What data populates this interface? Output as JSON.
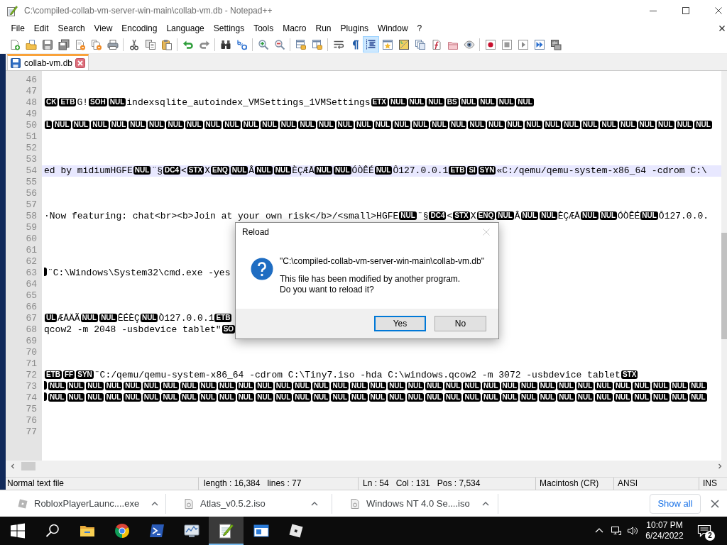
{
  "window": {
    "title": "C:\\compiled-collab-vm-server-win-main\\collab-vm.db - Notepad++"
  },
  "menu": [
    "File",
    "Edit",
    "Search",
    "View",
    "Encoding",
    "Language",
    "Settings",
    "Tools",
    "Macro",
    "Run",
    "Plugins",
    "Window",
    "?"
  ],
  "toolbar": [
    [
      {
        "kind": "new",
        "pressed": false
      },
      {
        "kind": "open",
        "pressed": false
      },
      {
        "kind": "save",
        "pressed": false
      },
      {
        "kind": "save_all",
        "pressed": false
      },
      {
        "kind": "close",
        "pressed": false
      },
      {
        "kind": "close_all",
        "pressed": false
      },
      {
        "kind": "print",
        "pressed": false
      }
    ],
    [
      {
        "kind": "cut",
        "pressed": false
      },
      {
        "kind": "copy",
        "pressed": false
      },
      {
        "kind": "paste",
        "pressed": false
      }
    ],
    [
      {
        "kind": "undo",
        "pressed": false
      },
      {
        "kind": "redo",
        "pressed": false
      }
    ],
    [
      {
        "kind": "find",
        "pressed": false
      },
      {
        "kind": "replace",
        "pressed": false
      }
    ],
    [
      {
        "kind": "zoom_in",
        "pressed": false
      },
      {
        "kind": "zoom_out",
        "pressed": false
      }
    ],
    [
      {
        "kind": "sync_v",
        "pressed": false
      },
      {
        "kind": "sync_h",
        "pressed": false
      }
    ],
    [
      {
        "kind": "wrap",
        "pressed": false
      },
      {
        "kind": "all_chars",
        "pressed": false
      },
      {
        "kind": "indent_guide",
        "pressed": true
      },
      {
        "kind": "user_lang",
        "pressed": false
      },
      {
        "kind": "doc_map",
        "pressed": false
      },
      {
        "kind": "doc_list",
        "pressed": false
      },
      {
        "kind": "func_list",
        "pressed": false
      },
      {
        "kind": "folder",
        "pressed": false
      },
      {
        "kind": "monitor",
        "pressed": false
      }
    ],
    [
      {
        "kind": "record",
        "pressed": false
      },
      {
        "kind": "stop",
        "pressed": false
      },
      {
        "kind": "play",
        "pressed": false
      },
      {
        "kind": "run_multi",
        "pressed": false
      },
      {
        "kind": "save_macro",
        "pressed": false
      }
    ]
  ],
  "tabs": [
    {
      "label": "collab-vm.db",
      "selected": true,
      "modified": false
    }
  ],
  "editor": {
    "lines": [
      {
        "number": "46",
        "current": false
      },
      {
        "number": "47",
        "current": false
      },
      {
        "number": "48",
        "current": false,
        "segments": [
          {
            "kind": "ctrl",
            "codes": [
              "CK",
              "ETB"
            ]
          },
          {
            "kind": "text",
            "text": "G!"
          },
          {
            "kind": "ctrl",
            "codes": [
              "SOH",
              "NUL"
            ]
          },
          {
            "kind": "text",
            "text": "indexsqlite_autoindex_VMSettings_1VMSettings"
          },
          {
            "kind": "ctrl",
            "codes": [
              "ETX",
              "NUL",
              "NUL",
              "NUL",
              "BS",
              "NUL",
              "NUL",
              "NUL",
              "NUL"
            ]
          }
        ]
      },
      {
        "number": "49",
        "current": false
      },
      {
        "number": "50",
        "current": false,
        "segments": [
          {
            "kind": "ctrl",
            "codes": [
              "L",
              "NUL",
              "NUL",
              "NUL",
              "NUL",
              "NUL",
              "NUL",
              "NUL",
              "NUL",
              "NUL",
              "NUL",
              "NUL",
              "NUL",
              "NUL",
              "NUL",
              "NUL",
              "NUL",
              "NUL",
              "NUL",
              "NUL",
              "NUL",
              "NUL",
              "NUL",
              "NUL",
              "NUL",
              "NUL",
              "NUL",
              "NUL",
              "NUL",
              "NUL",
              "NUL",
              "NUL",
              "NUL",
              "NUL",
              "NUL",
              "NUL"
            ]
          }
        ]
      },
      {
        "number": "51",
        "current": false
      },
      {
        "number": "52",
        "current": false
      },
      {
        "number": "53",
        "current": false
      },
      {
        "number": "54",
        "current": true,
        "segments": [
          {
            "kind": "text",
            "text": "ed by midiumHGFE"
          },
          {
            "kind": "ctrl",
            "codes": [
              "NUL"
            ]
          },
          {
            "kind": "text",
            "text": "¨§"
          },
          {
            "kind": "ctrl",
            "codes": [
              "DC4"
            ]
          },
          {
            "kind": "text",
            "text": "<"
          },
          {
            "kind": "ctrl",
            "codes": [
              "STX"
            ]
          },
          {
            "kind": "text",
            "text": "X"
          },
          {
            "kind": "ctrl",
            "codes": [
              "ENQ",
              "NUL"
            ]
          },
          {
            "kind": "text",
            "text": "Â"
          },
          {
            "kind": "ctrl",
            "codes": [
              "NUL",
              "NUL"
            ]
          },
          {
            "kind": "text",
            "text": "ÈÇÆÅ"
          },
          {
            "kind": "ctrl",
            "codes": [
              "NUL",
              "NUL"
            ]
          },
          {
            "kind": "text",
            "text": "ÓÒÊÉ"
          },
          {
            "kind": "ctrl",
            "codes": [
              "NUL"
            ]
          },
          {
            "kind": "text",
            "text": "Ô127.0.0.1"
          },
          {
            "kind": "ctrl",
            "codes": [
              "ETB",
              "SI",
              "SYN"
            ]
          },
          {
            "kind": "text",
            "text": "«C:/qemu/qemu-system-x86_64 -cdrom C:\\"
          }
        ]
      },
      {
        "number": "55",
        "current": false
      },
      {
        "number": "56",
        "current": false
      },
      {
        "number": "57",
        "current": false
      },
      {
        "number": "58",
        "current": false,
        "segments": [
          {
            "kind": "text",
            "text": "·Now featuring: chat<br><b>Join at your own risk</b>/<small>HGFE"
          },
          {
            "kind": "ctrl",
            "codes": [
              "NUL"
            ]
          },
          {
            "kind": "text",
            "text": "¨§"
          },
          {
            "kind": "ctrl",
            "codes": [
              "DC4"
            ]
          },
          {
            "kind": "text",
            "text": "<"
          },
          {
            "kind": "ctrl",
            "codes": [
              "STX"
            ]
          },
          {
            "kind": "text",
            "text": "X"
          },
          {
            "kind": "ctrl",
            "codes": [
              "ENQ",
              "NUL"
            ]
          },
          {
            "kind": "text",
            "text": "Â"
          },
          {
            "kind": "ctrl",
            "codes": [
              "NUL",
              "NUL"
            ]
          },
          {
            "kind": "text",
            "text": "ÈÇÆÅ"
          },
          {
            "kind": "ctrl",
            "codes": [
              "NUL",
              "NUL"
            ]
          },
          {
            "kind": "text",
            "text": "ÓÒÊÉ"
          },
          {
            "kind": "ctrl",
            "codes": [
              "NUL"
            ]
          },
          {
            "kind": "text",
            "text": "Ô127.0.0."
          }
        ]
      },
      {
        "number": "59",
        "current": false
      },
      {
        "number": "60",
        "current": false
      },
      {
        "number": "61",
        "current": false
      },
      {
        "number": "62",
        "current": false
      },
      {
        "number": "63",
        "current": false,
        "segments": [
          {
            "kind": "edge"
          },
          {
            "kind": "text",
            "text": "¨C:\\Windows\\System32\\cmd.exe -yes"
          }
        ]
      },
      {
        "number": "64",
        "current": false
      },
      {
        "number": "65",
        "current": false
      },
      {
        "number": "66",
        "current": false
      },
      {
        "number": "67",
        "current": false,
        "segments": [
          {
            "kind": "ctrl",
            "codes": [
              "UL"
            ]
          },
          {
            "kind": "text",
            "text": "ÆÅÄÃ"
          },
          {
            "kind": "ctrl",
            "codes": [
              "NUL",
              "NUL"
            ]
          },
          {
            "kind": "text",
            "text": "ÊÉÈÇ"
          },
          {
            "kind": "ctrl",
            "codes": [
              "NUL"
            ]
          },
          {
            "kind": "text",
            "text": "Ò127.0.0.1"
          },
          {
            "kind": "ctrl",
            "codes": [
              "ETB"
            ]
          }
        ]
      },
      {
        "number": "68",
        "current": false,
        "segments": [
          {
            "kind": "text",
            "text": "qcow2 -m 2048 -usbdevice tablet\""
          },
          {
            "kind": "ctrl",
            "codes": [
              "SO"
            ]
          }
        ]
      },
      {
        "number": "69",
        "current": false
      },
      {
        "number": "70",
        "current": false
      },
      {
        "number": "71",
        "current": false
      },
      {
        "number": "72",
        "current": false,
        "segments": [
          {
            "kind": "ctrl",
            "codes": [
              "ETB",
              "FF",
              "SYN"
            ]
          },
          {
            "kind": "text",
            "text": "¨C:/qemu/qemu-system-x86_64 -cdrom C:\\Tiny7.iso -hda C:\\windows.qcow2 -m 3072 -usbdevice tablet"
          },
          {
            "kind": "ctrl",
            "codes": [
              "STX"
            ]
          }
        ]
      },
      {
        "number": "73",
        "current": false,
        "segments": [
          {
            "kind": "edge"
          },
          {
            "kind": "ctrl",
            "codes": [
              "NUL",
              "NUL",
              "NUL",
              "NUL",
              "NUL",
              "NUL",
              "NUL",
              "NUL",
              "NUL",
              "NUL",
              "NUL",
              "NUL",
              "NUL",
              "NUL",
              "NUL",
              "NUL",
              "NUL",
              "NUL",
              "NUL",
              "NUL",
              "NUL",
              "NUL",
              "NUL",
              "NUL",
              "NUL",
              "NUL",
              "NUL",
              "NUL",
              "NUL",
              "NUL",
              "NUL",
              "NUL",
              "NUL",
              "NUL",
              "NUL"
            ]
          }
        ]
      },
      {
        "number": "74",
        "current": false,
        "segments": [
          {
            "kind": "edge"
          },
          {
            "kind": "ctrl",
            "codes": [
              "NUL",
              "NUL",
              "NUL",
              "NUL",
              "NUL",
              "NUL",
              "NUL",
              "NUL",
              "NUL",
              "NUL",
              "NUL",
              "NUL",
              "NUL",
              "NUL",
              "NUL",
              "NUL",
              "NUL",
              "NUL",
              "NUL",
              "NUL",
              "NUL",
              "NUL",
              "NUL",
              "NUL",
              "NUL",
              "NUL",
              "NUL",
              "NUL",
              "NUL",
              "NUL",
              "NUL",
              "NUL",
              "NUL",
              "NUL",
              "NUL"
            ]
          }
        ]
      },
      {
        "number": "75",
        "current": false
      },
      {
        "number": "76",
        "current": false
      },
      {
        "number": "77",
        "current": false
      }
    ]
  },
  "status_bar": [
    [
      "Normal text file"
    ],
    [
      "length : 16,384",
      "lines : 77"
    ],
    [
      "Ln : 54",
      "Col : 131",
      "Pos : 7,534"
    ],
    [
      "Macintosh (CR)"
    ],
    [
      "ANSI"
    ],
    [
      "INS"
    ]
  ],
  "dialog": {
    "title": "Reload",
    "close_disabled": true,
    "path": "\"C:\\compiled-collab-vm-server-win-main\\collab-vm.db\"",
    "message": [
      "This file has been modified by another program.",
      "Do you want to reload it?"
    ],
    "buttons": [
      {
        "label": "Yes",
        "default": true
      },
      {
        "label": "No",
        "default": false
      }
    ]
  },
  "downloads": {
    "items": [
      {
        "kind": "app",
        "name": "RobloxPlayerLaunc....exe"
      },
      {
        "kind": "disc_image",
        "name": "Atlas_v0.5.2.iso"
      },
      {
        "kind": "disc_image",
        "name": "Windows NT 4.0 Se....iso"
      }
    ],
    "show_all": "Show all"
  },
  "taskbar": {
    "buttons": [
      {
        "kind": "start",
        "active": false
      },
      {
        "kind": "search",
        "active": false
      },
      {
        "kind": "explorer",
        "active": false
      },
      {
        "kind": "browser",
        "active": false
      },
      {
        "kind": "terminal",
        "active": false
      },
      {
        "kind": "monitor",
        "active": false
      },
      {
        "kind": "notepad",
        "active": true
      },
      {
        "kind": "window",
        "active": false
      },
      {
        "kind": "game",
        "active": false
      }
    ],
    "clock": {
      "time": "10:07 PM",
      "date": "6/24/2022"
    },
    "notification_count": "2"
  }
}
